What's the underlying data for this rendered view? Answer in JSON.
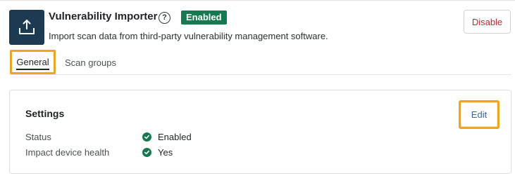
{
  "app": {
    "title": "Vulnerability Importer",
    "status_badge": "Enabled",
    "description": "Import scan data from third-party vulnerability management software.",
    "disable_label": "Disable",
    "icon": "upload-tray-icon",
    "help_icon_glyph": "?"
  },
  "tabs": [
    {
      "label": "General",
      "active": true
    },
    {
      "label": "Scan groups",
      "active": false
    }
  ],
  "settings": {
    "title": "Settings",
    "edit_label": "Edit",
    "rows": [
      {
        "label": "Status",
        "value": "Enabled",
        "icon": "check-circle-icon"
      },
      {
        "label": "Impact device health",
        "value": "Yes",
        "icon": "check-circle-icon"
      }
    ]
  },
  "colors": {
    "app_icon_bg": "#1c3a52",
    "badge_green": "#16794f",
    "highlight_orange": "#f0a51f",
    "disable_red": "#c0282d",
    "edit_blue": "#2e6ca7"
  }
}
